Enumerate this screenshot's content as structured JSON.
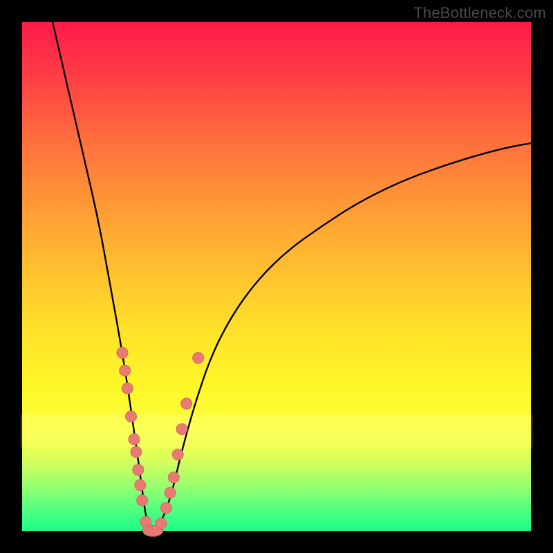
{
  "watermark": "TheBottleneck.com",
  "colors": {
    "frame_bg_top": "#ff1a4b",
    "frame_bg_bottom": "#1aff8a",
    "curve": "#000000",
    "marker_fill": "#e77b74",
    "marker_stroke": "#d86a63",
    "page_bg": "#000000"
  },
  "chart_data": {
    "type": "line",
    "title": "",
    "xlabel": "",
    "ylabel": "",
    "xlim": [
      0,
      1
    ],
    "ylim": [
      0,
      1
    ],
    "grid": false,
    "legend": false,
    "series": [
      {
        "name": "bottleneck-curve",
        "note": "V-shaped curve; y is fraction of plot height from bottom (0=bottom,1=top). Left branch steep/near-vertical, right branch tapers toward ~0.76 at x=1.",
        "x": [
          0.06,
          0.09,
          0.12,
          0.15,
          0.17,
          0.19,
          0.205,
          0.218,
          0.228,
          0.236,
          0.243,
          0.25,
          0.26,
          0.275,
          0.293,
          0.305,
          0.32,
          0.34,
          0.37,
          0.41,
          0.46,
          0.52,
          0.59,
          0.66,
          0.74,
          0.82,
          0.9,
          0.96,
          1.0
        ],
        "y": [
          1.0,
          0.87,
          0.74,
          0.61,
          0.5,
          0.39,
          0.3,
          0.21,
          0.14,
          0.08,
          0.03,
          0.0,
          0.0,
          0.02,
          0.07,
          0.12,
          0.18,
          0.25,
          0.34,
          0.42,
          0.49,
          0.55,
          0.6,
          0.645,
          0.685,
          0.715,
          0.74,
          0.755,
          0.762
        ]
      }
    ],
    "markers": {
      "name": "sample-points",
      "note": "salmon dots clustered along the V near the bottom",
      "points": [
        {
          "x": 0.197,
          "y": 0.35
        },
        {
          "x": 0.202,
          "y": 0.315
        },
        {
          "x": 0.207,
          "y": 0.28
        },
        {
          "x": 0.214,
          "y": 0.225
        },
        {
          "x": 0.22,
          "y": 0.18
        },
        {
          "x": 0.224,
          "y": 0.155
        },
        {
          "x": 0.228,
          "y": 0.12
        },
        {
          "x": 0.232,
          "y": 0.09
        },
        {
          "x": 0.236,
          "y": 0.06
        },
        {
          "x": 0.243,
          "y": 0.018
        },
        {
          "x": 0.248,
          "y": 0.002
        },
        {
          "x": 0.254,
          "y": 0.0
        },
        {
          "x": 0.26,
          "y": 0.0
        },
        {
          "x": 0.266,
          "y": 0.002
        },
        {
          "x": 0.273,
          "y": 0.015
        },
        {
          "x": 0.283,
          "y": 0.045
        },
        {
          "x": 0.291,
          "y": 0.075
        },
        {
          "x": 0.298,
          "y": 0.105
        },
        {
          "x": 0.306,
          "y": 0.15
        },
        {
          "x": 0.314,
          "y": 0.2
        },
        {
          "x": 0.323,
          "y": 0.25
        },
        {
          "x": 0.346,
          "y": 0.34
        }
      ]
    }
  }
}
